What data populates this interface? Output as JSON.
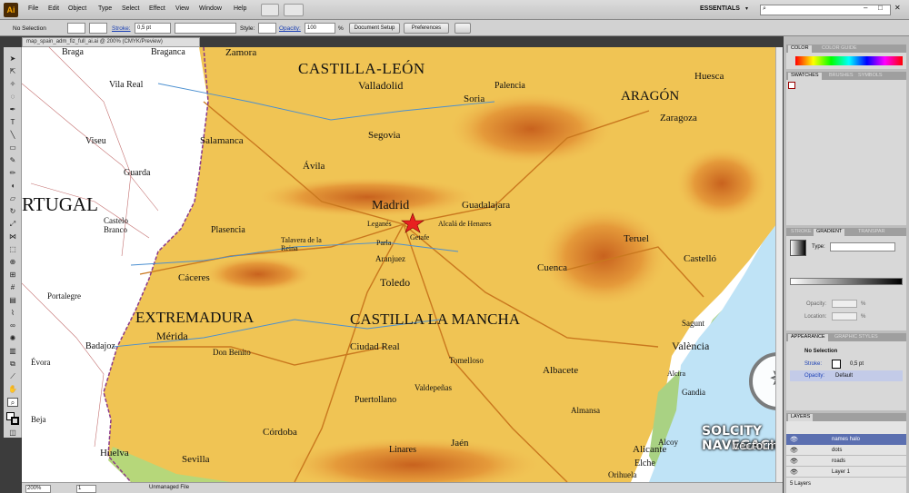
{
  "app": {
    "logo": "Ai",
    "menus": [
      "File",
      "Edit",
      "Object",
      "Type",
      "Select",
      "Effect",
      "View",
      "Window",
      "Help"
    ],
    "workspace": "ESSENTIALS"
  },
  "control_bar": {
    "selection": "No Selection",
    "stroke_label": "Stroke:",
    "stroke_value": "0,5 pt",
    "style_label": "Style:",
    "opacity_label": "Opacity:",
    "opacity_value": "100",
    "percent": "%",
    "document_setup": "Document Setup",
    "preferences": "Preferences"
  },
  "document": {
    "tab_title": "map_spain_adm_fiz_full_ai.ai @ 200% (CMYK/Preview)",
    "zoom": "200%",
    "page": "1",
    "status": "Unmanaged File"
  },
  "map": {
    "regions": [
      "CASTILLA-LEÓN",
      "ARAGÓN",
      "EXTREMADURA",
      "CASTILLA LA MANCHA",
      "RTUGAL"
    ],
    "cities": [
      "Zamora",
      "Braganca",
      "Braga",
      "Vila Real",
      "Viseu",
      "Guarda",
      "Castelo Branco",
      "Portalegre",
      "Évora",
      "Beja",
      "Valladolid",
      "Palencia",
      "Soria",
      "Huesca",
      "Zaragoza",
      "Salamanca",
      "Segovia",
      "Ávila",
      "Madrid",
      "Guadalajara",
      "Toledo",
      "Cuenca",
      "Teruel",
      "Castelló",
      "Cáceres",
      "Plasencia",
      "Mérida",
      "Badajoz",
      "Ciudad Real",
      "Albacete",
      "València",
      "Alicante",
      "Córdoba",
      "Jaén",
      "Sevilla",
      "Huelva",
      "Linares",
      "Puertollano",
      "Elche",
      "Gandia",
      "Sagunt",
      "Aranjuez",
      "Getafe",
      "Leganés",
      "Parla",
      "Alcalá de Henares",
      "Talavera de la Reina",
      "Don Benito",
      "Valdepeñas",
      "Tomelloso",
      "Almansa",
      "Alcoy",
      "Orihuela",
      "Alcira"
    ],
    "watermark_line1": "SOLCITY NAVEGACIÓN",
    "watermark_line2": "vectormap.info"
  },
  "panels": {
    "color_tabs": [
      "COLOR",
      "COLOR GUIDE"
    ],
    "swatch_tabs": [
      "SWATCHES",
      "BRUSHES",
      "SYMBOLS"
    ],
    "gradient_tabs": [
      "STROKE",
      "GRADIENT",
      "TRANSPAR"
    ],
    "gradient_type_label": "Type:",
    "gradient_opacity_label": "Opacity:",
    "gradient_location_label": "Location:",
    "gradient_percent": "%",
    "appearance_tabs": [
      "APPEARANCE",
      "GRAPHIC STYLES"
    ],
    "appearance_selection": "No Selection",
    "appearance_stroke_label": "Stroke:",
    "appearance_stroke_value": "0,5 pt",
    "appearance_opacity_label": "Opacity:",
    "appearance_opacity_value": "Default",
    "layers_tab": "LAYERS",
    "layers": [
      "names halo",
      "dots",
      "roads",
      "Layer 1"
    ],
    "layers_count": "5 Layers"
  }
}
